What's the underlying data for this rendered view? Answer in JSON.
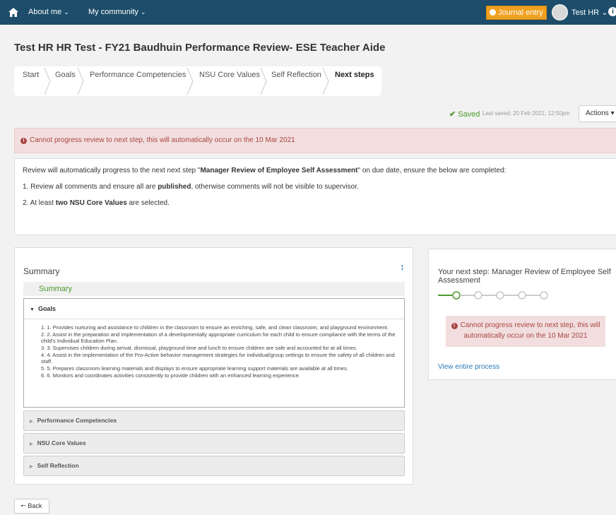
{
  "nav": {
    "about": "About me",
    "community": "My community",
    "journal": "Journal entry",
    "user": "Test HR",
    "home_icon": "home-icon",
    "info_icon": "info-icon"
  },
  "page": {
    "title": "Test HR HR Test - FY21 Baudhuin Performance Review- ESE Teacher Aide"
  },
  "breadcrumb": [
    {
      "label": "Start"
    },
    {
      "label": "Goals"
    },
    {
      "label": "Performance Competencies"
    },
    {
      "label": "NSU Core Values"
    },
    {
      "label": "Self Reflection"
    },
    {
      "label": "Next steps",
      "active": true
    }
  ],
  "status": {
    "saved": "Saved",
    "last_saved": "Last saved: 20 Feb 2021, 12:50pm",
    "actions": "Actions"
  },
  "alert": {
    "text": "Cannot progress review to next step, this will automatically occur on the 10 Mar 2021"
  },
  "info": {
    "line1_pre": "Review will automatically progress to the next next step \"",
    "line1_bold": "Manager Review of Employee Self Assessment",
    "line1_post": "\" on due date, ensure the below are completed:",
    "line2_pre": "1. Review all comments and ensure all are ",
    "line2_bold": "published",
    "line2_post": ", otherwise comments will not be visible to supervisor.",
    "line3_pre": "2. At least ",
    "line3_bold": "two NSU Core Values",
    "line3_post": " are selected."
  },
  "summary": {
    "title": "Summary",
    "subtitle": "Summary",
    "goals_label": "Goals",
    "goals": [
      "1. 1. Provides nurturing and assistance to children in the classroom to ensure an enriching, safe, and clean classroom, and playground environment.",
      "2. 2. Assist in the preparation and implementation of a developmentally appropriate curriculum for each child to ensure compliance with the terms of the child's Individual Education Plan.",
      "3. 3. Supervises children during arrival, dismissal, playground time and lunch to ensure children are safe and accounted for at all times.",
      "4. 4. Assist in the implementation of the Pro-Active behavior management strategies for individual/group settings to ensure the safety of all children and staff.",
      "5. 5. Prepares classroom learning materials and displays to ensure appropriate learning support materials are available at all times.",
      "6. 6. Monitors and coordinates activities consistently to provide children with an enhanced learning experience."
    ],
    "sections": [
      "Performance Competencies",
      "NSU Core Values",
      "Self Reflection"
    ]
  },
  "next_step": {
    "title": "Your next step: Manager Review of Employee Self Assessment",
    "alert": "Cannot progress review to next step, this will automatically occur on the 10 Mar 2021",
    "link": "View entire process",
    "steps_total": 5,
    "current_step": 1
  },
  "back": "Back",
  "colors": {
    "navbar": "#1d4d6a",
    "journal": "#f0a020",
    "saved": "#4a9a2a",
    "alert_bg": "#f2dede",
    "alert_text": "#a94442",
    "link": "#2a7ab8"
  }
}
